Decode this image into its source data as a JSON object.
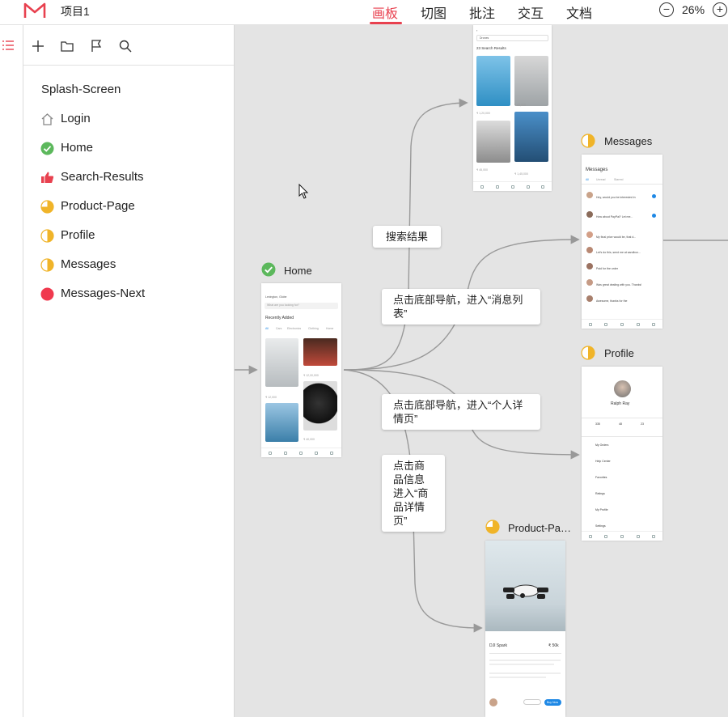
{
  "app": {
    "project_title": "项目1",
    "nav_tabs": [
      {
        "label": "画板",
        "active": true
      },
      {
        "label": "切图",
        "active": false
      },
      {
        "label": "批注",
        "active": false
      },
      {
        "label": "交互",
        "active": false
      },
      {
        "label": "文档",
        "active": false
      }
    ],
    "zoom": {
      "minus": "−",
      "value": "26%",
      "plus": "+"
    },
    "accent_color": "#e8414f"
  },
  "sidebar": {
    "toolbar_icons": [
      "add-icon",
      "folder-icon",
      "flag-icon",
      "search-icon"
    ],
    "pages": [
      {
        "label": "Splash-Screen",
        "icon": "none"
      },
      {
        "label": "Login",
        "icon": "home-outline-icon"
      },
      {
        "label": "Home",
        "icon": "check-circle-icon",
        "color": "#5cb85c"
      },
      {
        "label": "Search-Results",
        "icon": "thumbs-up-icon",
        "color": "#e8414f"
      },
      {
        "label": "Product-Page",
        "icon": "pie-three-quarter-icon",
        "color": "#f0b429"
      },
      {
        "label": "Profile",
        "icon": "half-circle-icon",
        "color": "#f0b429"
      },
      {
        "label": "Messages",
        "icon": "half-circle-icon",
        "color": "#f0b429"
      },
      {
        "label": "Messages-Next",
        "icon": "red-dot-icon",
        "color": "#f0394e"
      }
    ]
  },
  "canvas": {
    "artboards": {
      "home": {
        "label": "Home",
        "search_placeholder": "What are you looking for?",
        "location": "Lexington, Globe",
        "section": "Recently Added",
        "filters": [
          "All",
          "Cars",
          "Electronics",
          "Clothing",
          "Home"
        ],
        "items": [
          {
            "price": "₹ 12,000"
          },
          {
            "price": "₹ 12,00,000"
          },
          {
            "price": "₹ 40,000"
          }
        ]
      },
      "search_results": {
        "filter": "Drones",
        "header": "23 Search Results",
        "prices": [
          "₹ 1,20,000",
          "₹ 65,000",
          "₹ 45,000",
          "₹ 1,45,000"
        ]
      },
      "messages": {
        "label": "Messages",
        "title": "Messages",
        "tabs": [
          "All",
          "Unread",
          "Starred"
        ],
        "previews": [
          "Hey, would you be interested in",
          "How about PayPal? Let me...",
          "My final price would be, that d...",
          "Let's do this, send me at sandbox...",
          "Paid for the order",
          "Was great dealing with you. Thanks!",
          "Awesome, thanks for the"
        ]
      },
      "profile": {
        "label": "Profile",
        "name": "Ralph Ray",
        "stats": [
          "335",
          "48",
          "23"
        ],
        "menu": [
          "My Orders",
          "Help Center",
          "Favorites",
          "Ratings",
          "My Profile",
          "Settings"
        ]
      },
      "product": {
        "label": "Product-Pa…",
        "name": "DJI Spark",
        "price": "₹ 50k",
        "button": "Buy Now"
      }
    },
    "annotations": [
      {
        "text": "搜索结果"
      },
      {
        "text": "点击底部导航，进入“消息列表”"
      },
      {
        "text": "点击底部导航，进入“个人详情页”"
      },
      {
        "text": "点击商品信息进入“商品详情页”"
      }
    ]
  }
}
